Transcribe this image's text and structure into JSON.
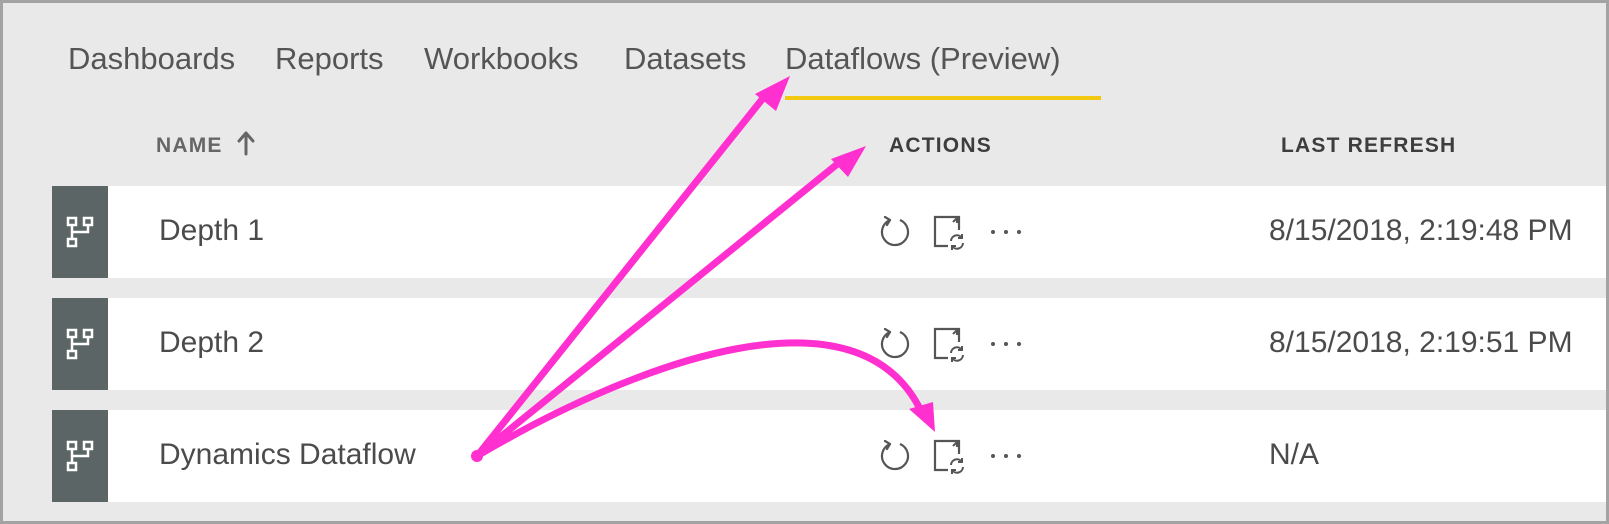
{
  "tabs": [
    {
      "label": "Dashboards"
    },
    {
      "label": "Reports"
    },
    {
      "label": "Workbooks"
    },
    {
      "label": "Datasets"
    },
    {
      "label": "Dataflows (Preview)",
      "active": true
    }
  ],
  "columns": {
    "name": "NAME",
    "actions": "ACTIONS",
    "last_refresh": "LAST REFRESH"
  },
  "rows": [
    {
      "icon": "dataflow-icon",
      "name": "Depth 1",
      "last_refresh": "8/15/2018, 2:19:48 PM"
    },
    {
      "icon": "dataflow-icon",
      "name": "Depth 2",
      "last_refresh": "8/15/2018, 2:19:51 PM"
    },
    {
      "icon": "dataflow-icon",
      "name": "Dynamics Dataflow",
      "last_refresh": "N/A"
    }
  ],
  "row_actions": [
    "refresh-icon",
    "schedule-refresh-icon",
    "more-options-icon"
  ],
  "colors": {
    "background": "#e9e9e9",
    "active_tab_underline": "#f2c811",
    "row_icon_bg": "#5b6566",
    "annotation_arrow": "#ff2fd0"
  }
}
